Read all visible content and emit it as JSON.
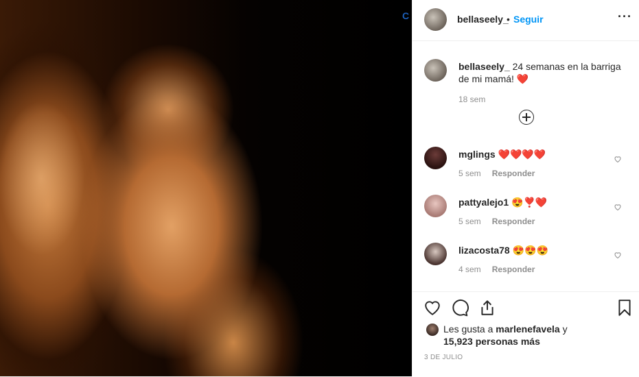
{
  "photo": {
    "overlay_label": "C"
  },
  "header": {
    "username": "bellaseely_",
    "separator": "•",
    "follow_label": "Seguir",
    "more_label": "···"
  },
  "caption": {
    "username": "bellaseely_",
    "text": " 24 semanas en la barriga de mi mamá! ❤️",
    "time": "18 sem"
  },
  "comments": [
    {
      "username": "mglings",
      "text": "❤️❤️❤️❤️",
      "time": "5 sem",
      "reply_label": "Responder"
    },
    {
      "username": "pattyalejo1",
      "text": "😍❣️❤️",
      "time": "5 sem",
      "reply_label": "Responder"
    },
    {
      "username": "lizacosta78",
      "text": "😍😍😍",
      "time": "4 sem",
      "reply_label": "Responder"
    }
  ],
  "likes": {
    "prefix": "Les gusta a ",
    "liker": "marlenefavela",
    "connector": " y",
    "count_text": "15,923 personas más"
  },
  "date": "3 DE JULIO",
  "colors": {
    "accent": "#0095f6",
    "text": "#262626",
    "muted": "#8e8e8e"
  }
}
